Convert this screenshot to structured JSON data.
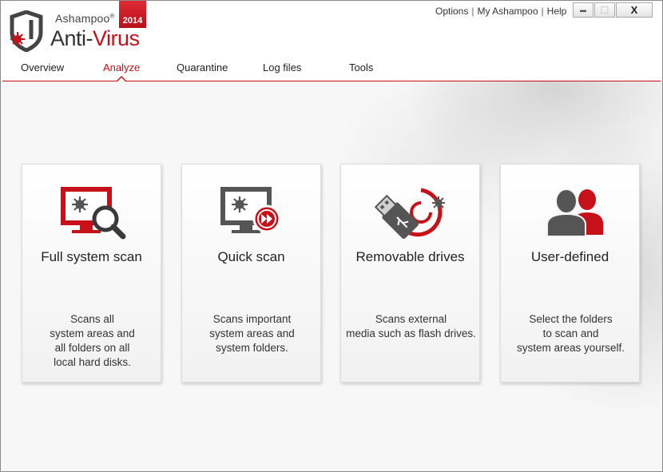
{
  "app": {
    "brand": "Ashampoo",
    "brand_mark": "®",
    "product_part1": "Anti-",
    "product_part2": "Virus",
    "year": "2014"
  },
  "toplinks": {
    "options": "Options",
    "my_account": "My Ashampoo",
    "help": "Help",
    "separator": "|"
  },
  "window_buttons": {
    "minimize": "▬",
    "maximize": "☐",
    "close": "X"
  },
  "tabs": [
    {
      "label": "Overview",
      "active": false
    },
    {
      "label": "Analyze",
      "active": true
    },
    {
      "label": "Quarantine",
      "active": false
    },
    {
      "label": "Log files",
      "active": false
    },
    {
      "label": "Tools",
      "active": false
    }
  ],
  "cards": [
    {
      "icon": "monitor-magnifier-icon",
      "title": "Full system scan",
      "desc": [
        "Scans all",
        "system areas and",
        "all folders on all",
        "local hard disks."
      ]
    },
    {
      "icon": "monitor-fast-forward-icon",
      "title": "Quick scan",
      "desc": [
        "Scans important",
        "system areas and",
        "system folders."
      ]
    },
    {
      "icon": "usb-drive-icon",
      "title": "Removable drives",
      "desc": [
        "Scans external",
        "media such as flash drives."
      ]
    },
    {
      "icon": "users-icon",
      "title": "User-defined",
      "desc": [
        "Select the folders",
        "to scan and",
        "system areas yourself."
      ]
    }
  ],
  "colors": {
    "accent": "#c7111a",
    "icon_gray": "#555555"
  }
}
